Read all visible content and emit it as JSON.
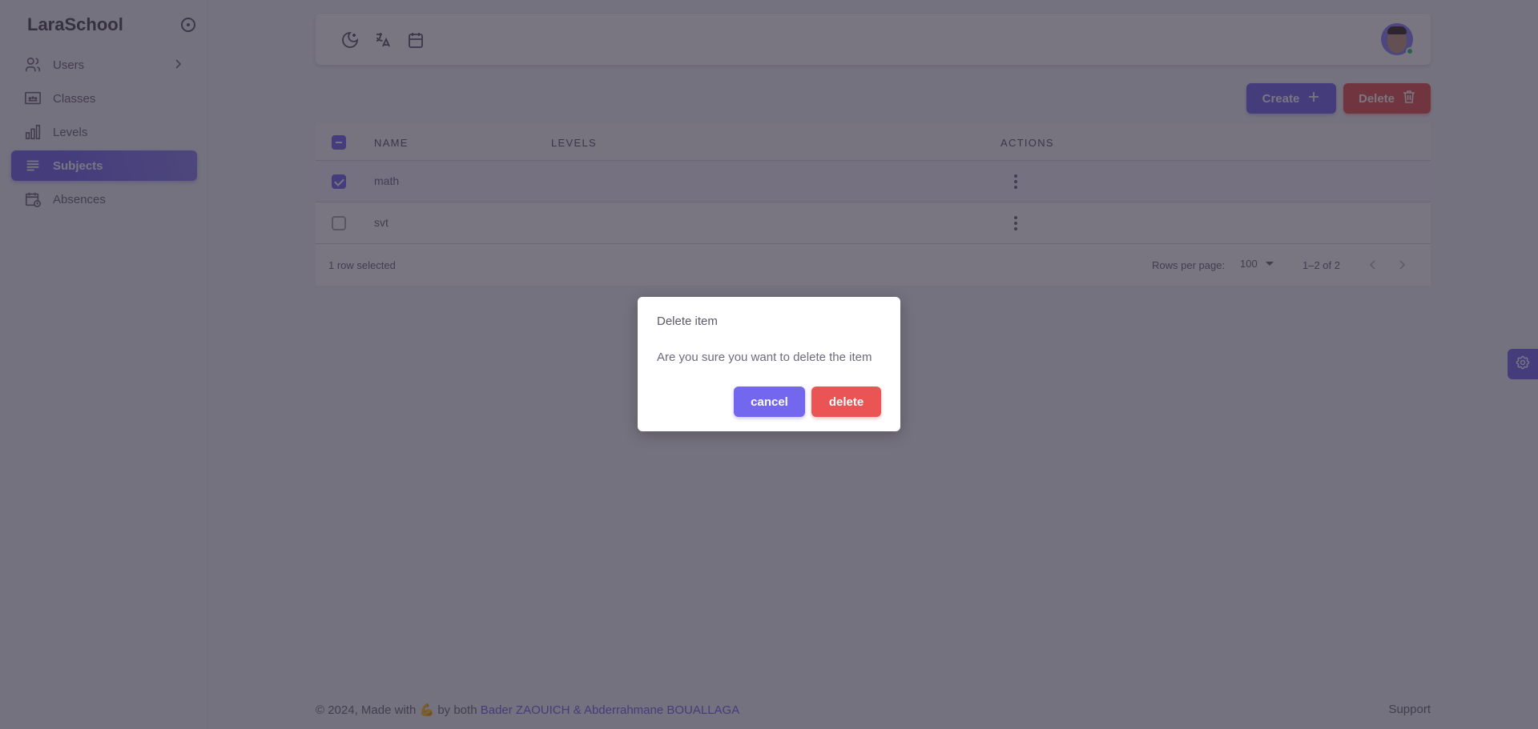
{
  "app": {
    "brand": "LaraSchool"
  },
  "sidebar": {
    "items": [
      {
        "label": "Users",
        "icon": "users-icon",
        "has_submenu": true,
        "active": false
      },
      {
        "label": "Classes",
        "icon": "presentation-icon",
        "active": false
      },
      {
        "label": "Levels",
        "icon": "bar-chart-icon",
        "active": false
      },
      {
        "label": "Subjects",
        "icon": "list-icon",
        "active": true
      },
      {
        "label": "Absences",
        "icon": "calendar-clock-icon",
        "active": false
      }
    ]
  },
  "topbar": {
    "icons": [
      "moon-stars-icon",
      "translate-icon",
      "calendar-icon"
    ],
    "user_status": "online"
  },
  "toolbar": {
    "create_label": "Create",
    "delete_label": "Delete"
  },
  "table": {
    "columns": [
      "NAME",
      "LEVELS",
      "ACTIONS"
    ],
    "header_checkbox": "indeterminate",
    "rows": [
      {
        "name": "math",
        "levels": "",
        "selected": true
      },
      {
        "name": "svt",
        "levels": "",
        "selected": false
      }
    ],
    "footer": {
      "selected_text": "1 row selected",
      "rows_per_page_label": "Rows per page:",
      "rows_per_page_value": "100",
      "range_text": "1–2 of 2"
    }
  },
  "footer": {
    "prefix": "© 2024, Made with",
    "emoji": "💪",
    "middle": "by both",
    "author1": "Bader ZAOUICH",
    "amp": "&",
    "author2": "Abderrahmane BOUALLAGA",
    "support": "Support"
  },
  "dialog": {
    "title": "Delete item",
    "message": "Are you sure you want to delete the item",
    "cancel_label": "cancel",
    "confirm_label": "delete"
  },
  "colors": {
    "primary": "#7367f0",
    "danger": "#ea5455",
    "success": "#28c76f"
  }
}
